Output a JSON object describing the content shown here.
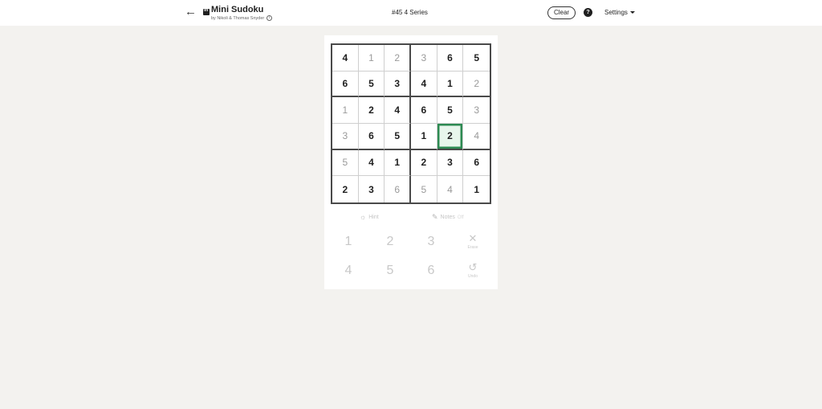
{
  "header": {
    "title": "Mini Sudoku",
    "subtitle": "by Nikoli & Thomas Snyder",
    "puzzle_id": "#45 4 Series",
    "clear_label": "Clear",
    "help_symbol": "?",
    "settings_label": "Settings",
    "back_symbol": "←",
    "info_symbol": "i"
  },
  "board": {
    "rows": [
      [
        {
          "v": "4",
          "t": "given"
        },
        {
          "v": "1",
          "t": "filled"
        },
        {
          "v": "2",
          "t": "filled"
        },
        {
          "v": "3",
          "t": "filled"
        },
        {
          "v": "6",
          "t": "given"
        },
        {
          "v": "5",
          "t": "given"
        }
      ],
      [
        {
          "v": "6",
          "t": "given"
        },
        {
          "v": "5",
          "t": "given"
        },
        {
          "v": "3",
          "t": "given"
        },
        {
          "v": "4",
          "t": "given"
        },
        {
          "v": "1",
          "t": "given"
        },
        {
          "v": "2",
          "t": "filled"
        }
      ],
      [
        {
          "v": "1",
          "t": "filled"
        },
        {
          "v": "2",
          "t": "given"
        },
        {
          "v": "4",
          "t": "given"
        },
        {
          "v": "6",
          "t": "given"
        },
        {
          "v": "5",
          "t": "given"
        },
        {
          "v": "3",
          "t": "filled"
        }
      ],
      [
        {
          "v": "3",
          "t": "filled"
        },
        {
          "v": "6",
          "t": "given"
        },
        {
          "v": "5",
          "t": "given"
        },
        {
          "v": "1",
          "t": "given"
        },
        {
          "v": "2",
          "t": "given"
        },
        {
          "v": "4",
          "t": "filled"
        }
      ],
      [
        {
          "v": "5",
          "t": "filled"
        },
        {
          "v": "4",
          "t": "given"
        },
        {
          "v": "1",
          "t": "given"
        },
        {
          "v": "2",
          "t": "given"
        },
        {
          "v": "3",
          "t": "given"
        },
        {
          "v": "6",
          "t": "given"
        }
      ],
      [
        {
          "v": "2",
          "t": "given"
        },
        {
          "v": "3",
          "t": "given"
        },
        {
          "v": "6",
          "t": "filled"
        },
        {
          "v": "5",
          "t": "filled"
        },
        {
          "v": "4",
          "t": "filled"
        },
        {
          "v": "1",
          "t": "given"
        }
      ]
    ],
    "selected": {
      "row": 3,
      "col": 4
    },
    "accent_color": "#2d8a52"
  },
  "tools": {
    "hint_label": "Hint",
    "notes_label": "Notes",
    "notes_toggle": "Off"
  },
  "pad": {
    "numbers": [
      "1",
      "2",
      "3",
      "4",
      "5",
      "6"
    ],
    "erase_label": "Erase",
    "undo_label": "Undo"
  }
}
